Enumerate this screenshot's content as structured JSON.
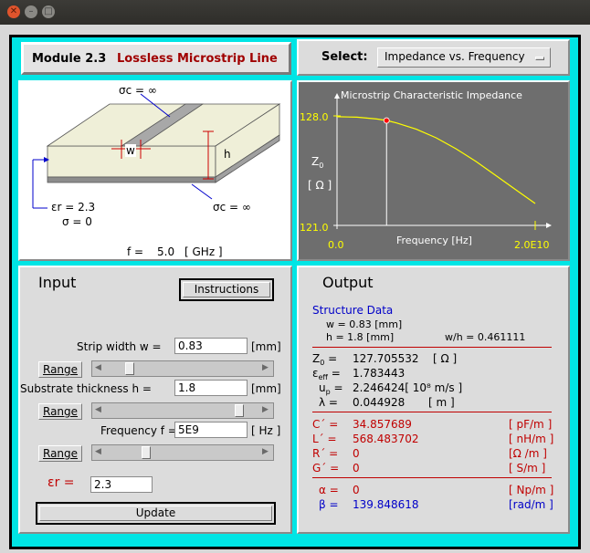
{
  "window": {
    "close_icon": "close-icon",
    "minimize_icon": "minimize-icon",
    "maximize_icon": "maximize-icon"
  },
  "header": {
    "module_number": "Module 2.3",
    "module_title": "Lossless Microstrip Line",
    "select_label": "Select:",
    "select_value": "Impedance vs. Frequency"
  },
  "diagram": {
    "sigma_c_top": "σc = ∞",
    "sigma_c_bottom": "σc = ∞",
    "w_label": "w",
    "h_label": "h",
    "eps_r": "εr = 2.3",
    "sigma": "σ = 0",
    "freq_prefix": "f =",
    "freq_value": "5.0",
    "freq_unit": "[ GHz ]"
  },
  "plot": {
    "title": "Microstrip Characteristic Impedance",
    "y_symbol": "Z0",
    "y_unit": "[ Ω ]",
    "y_top": "128.0",
    "y_bottom": "121.0",
    "x_left": "0.0",
    "x_right": "2.0E10",
    "x_label": "Frequency [Hz]",
    "colors": {
      "background": "#6e6e6e",
      "curve": "#ffff00",
      "axis": "#ffffff",
      "marker": "#ff0000"
    }
  },
  "chart_data": {
    "type": "line",
    "title": "Microstrip Characteristic Impedance",
    "xlabel": "Frequency [Hz]",
    "ylabel": "Z0 [ Ω ]",
    "xlim": [
      0,
      20000000000
    ],
    "ylim": [
      121.0,
      128.0
    ],
    "x": [
      0,
      2000000000,
      4000000000,
      5000000000,
      6000000000,
      8000000000,
      10000000000,
      12000000000,
      14000000000,
      16000000000,
      18000000000,
      20000000000
    ],
    "series": [
      {
        "values": [
          127.95,
          127.92,
          127.8,
          127.71,
          127.55,
          127.15,
          126.6,
          125.9,
          125.1,
          124.2,
          123.3,
          122.4
        ]
      }
    ],
    "marker": {
      "x": 5000000000,
      "y": 127.705532
    }
  },
  "input": {
    "heading": "Input",
    "instructions_label": "Instructions",
    "strip_width_label": "Strip width w  =",
    "strip_width_value": "0.83",
    "strip_width_unit": "[mm]",
    "thickness_label": "Substrate thickness  h  =",
    "thickness_value": "1.8",
    "thickness_unit": "[mm]",
    "frequency_label": "Frequency   f  =",
    "frequency_value": "5E9",
    "frequency_unit": "[ Hz ]",
    "range_label": "Range",
    "eps_label": "εr =",
    "eps_value": "2.3",
    "update_label": "Update",
    "slider_w_level": 0.14,
    "slider_h_level": 0.9,
    "slider_f_level": 0.25
  },
  "output": {
    "heading": "Output",
    "structure_title": "Structure Data",
    "w_line": "w =  0.83 [mm]",
    "h_line": "h =  1.8 [mm]",
    "wh_line": "w/h  =  0.461111",
    "z0_label": "Z0 =",
    "z0_value": "127.705532",
    "z0_unit": "[ Ω ]",
    "eeff_label": "εeff =",
    "eeff_value": "1.783443",
    "up_label": "up =",
    "up_value": "2.246424[ 10⁸ m/s ]",
    "lambda_label": "λ =",
    "lambda_value": "0.044928",
    "lambda_unit": "[ m ]",
    "C_label": "C´ =",
    "C_value": "34.857689",
    "C_unit": "[ pF/m ]",
    "L_label": "L´ =",
    "L_value": "568.483702",
    "L_unit": "[ nH/m ]",
    "R_label": "R´ =",
    "R_value": "0",
    "R_unit": "[Ω  /m ]",
    "G_label": "G´ =",
    "G_value": "0",
    "G_unit": "[ S/m ]",
    "alpha_label": "α =",
    "alpha_value": "0",
    "alpha_unit": "[ Np/m ]",
    "beta_label": "β =",
    "beta_value": "139.848618",
    "beta_unit": "[rad/m ]"
  }
}
